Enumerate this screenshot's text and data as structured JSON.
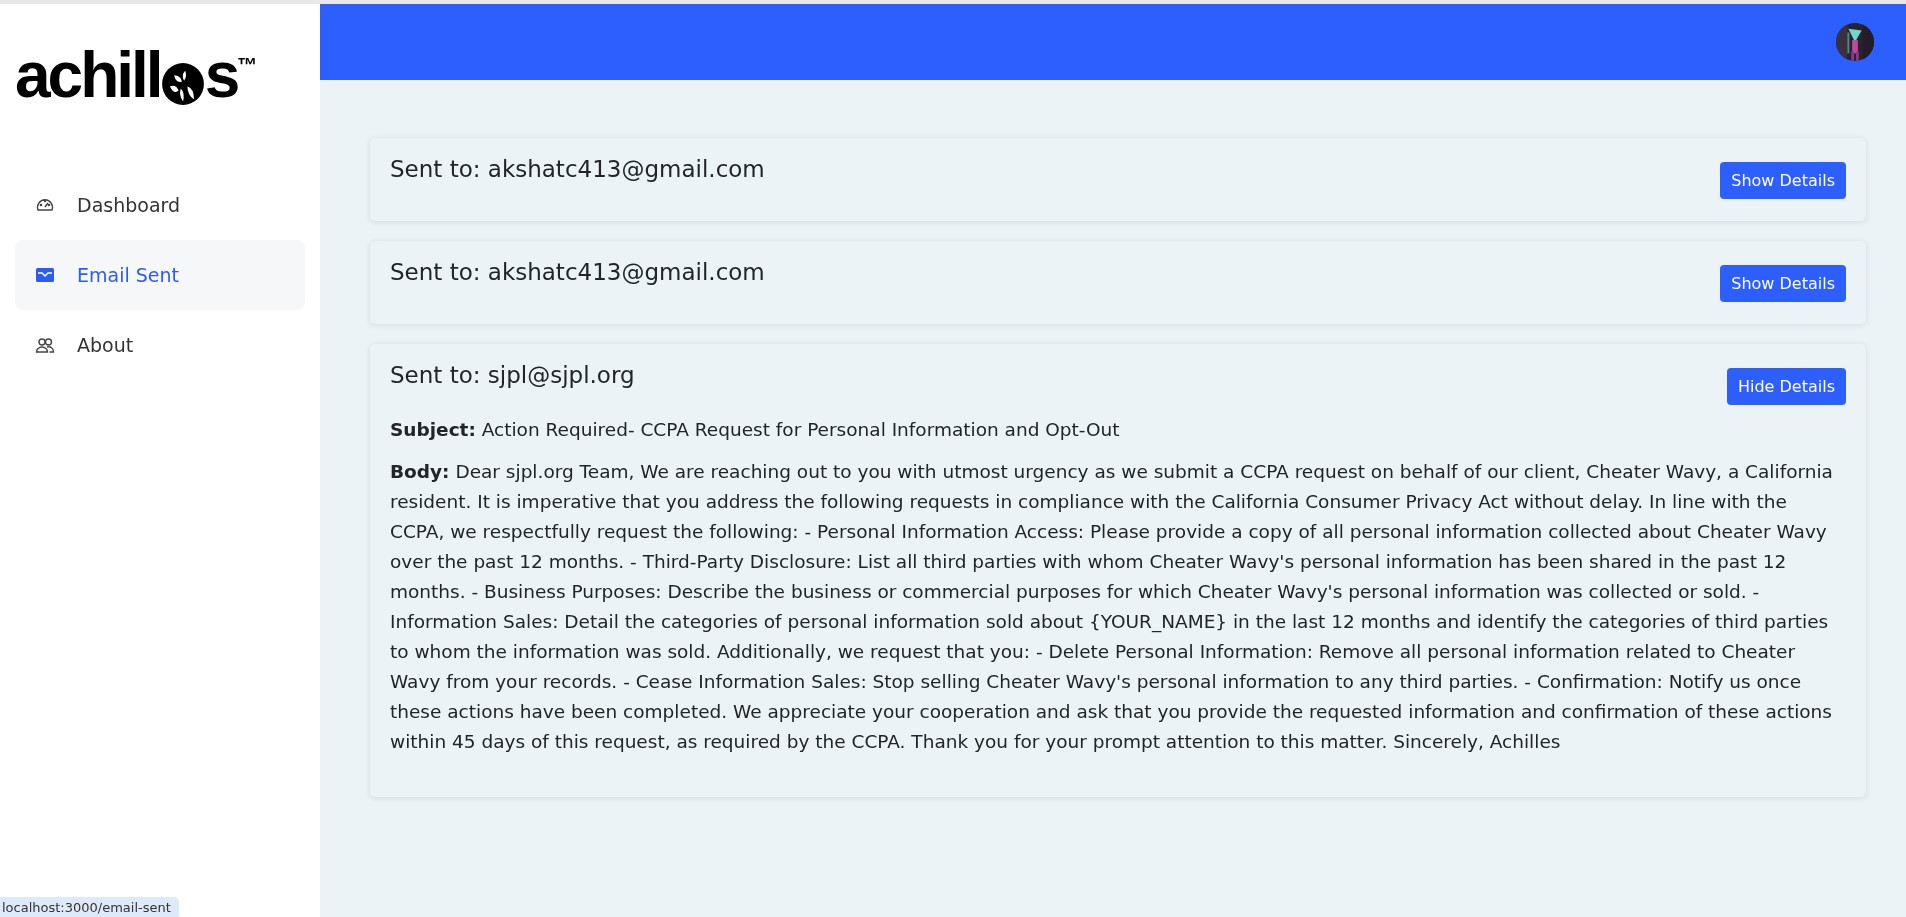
{
  "logo": {
    "before": "achill",
    "after": "s",
    "mark": "™"
  },
  "sidebar": {
    "items": [
      {
        "label": "Dashboard",
        "selected": false
      },
      {
        "label": "Email Sent",
        "selected": true
      },
      {
        "label": "About",
        "selected": false
      }
    ]
  },
  "emails": [
    {
      "recipient": "Sent to: akshatc413@gmail.com",
      "button": "Show Details",
      "expanded": false
    },
    {
      "recipient": "Sent to: akshatc413@gmail.com",
      "button": "Show Details",
      "expanded": false
    },
    {
      "recipient": "Sent to: sjpl@sjpl.org",
      "button": "Hide Details",
      "expanded": true,
      "subject": "**Subject:** Action Required- CCPA Request for Personal Information and Opt-Out",
      "body": "**Body:** Dear sjpl.org Team, We are reaching out to you with utmost urgency as we submit a CCPA request on behalf of our client, Cheater Wavy, a California resident. It is imperative that you address the following requests in compliance with the California Consumer Privacy Act without delay. In line with the CCPA, we respectfully request the following: - Personal Information Access: Please provide a copy of all personal information collected about Cheater Wavy over the past 12 months. - Third-Party Disclosure: List all third parties with whom Cheater Wavy's personal information has been shared in the past 12 months. - Business Purposes: Describe the business or commercial purposes for which Cheater Wavy's personal information was collected or sold. - Information Sales: Detail the categories of personal information sold about {YOUR_NAME} in the last 12 months and identify the categories of third parties to whom the information was sold. Additionally, we request that you: - Delete Personal Information: Remove all personal information related to Cheater Wavy from your records. - Cease Information Sales: Stop selling Cheater Wavy's personal information to any third parties. - Confirmation: Notify us once these actions have been completed. We appreciate your cooperation and ask that you provide the requested information and confirmation of these actions within 45 days of this request, as required by the CCPA. Thank you for your prompt attention to this matter. Sincerely, Achilles"
    }
  ],
  "status_bar": "localhost:3000/email-sent"
}
